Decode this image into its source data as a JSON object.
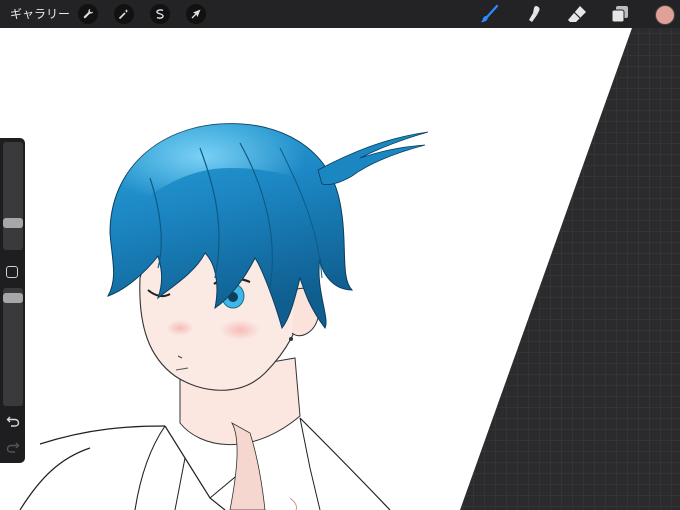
{
  "toolbar": {
    "gallery_label": "ギャラリー",
    "left_tools": [
      {
        "name": "actions",
        "icon": "wrench-icon"
      },
      {
        "name": "adjustments",
        "icon": "magic-wand-icon"
      },
      {
        "name": "selection",
        "icon": "selection-s-icon"
      },
      {
        "name": "transform",
        "icon": "arrow-cursor-icon"
      }
    ],
    "right_tools": [
      {
        "name": "brush",
        "icon": "brush-icon",
        "active": true
      },
      {
        "name": "smudge",
        "icon": "smudge-icon"
      },
      {
        "name": "eraser",
        "icon": "eraser-icon"
      },
      {
        "name": "layers",
        "icon": "layers-icon"
      }
    ],
    "color": "#e0a196"
  },
  "sidebar": {
    "brush_size_level": 0.22,
    "opacity_level": 0.95,
    "undo_icon": "undo-icon",
    "redo_icon": "redo-icon"
  },
  "colors": {
    "accent": "#2f8cff",
    "hair": "#1e8fc7",
    "skin": "#fbe6df",
    "workspace": "#2b2b2d"
  }
}
